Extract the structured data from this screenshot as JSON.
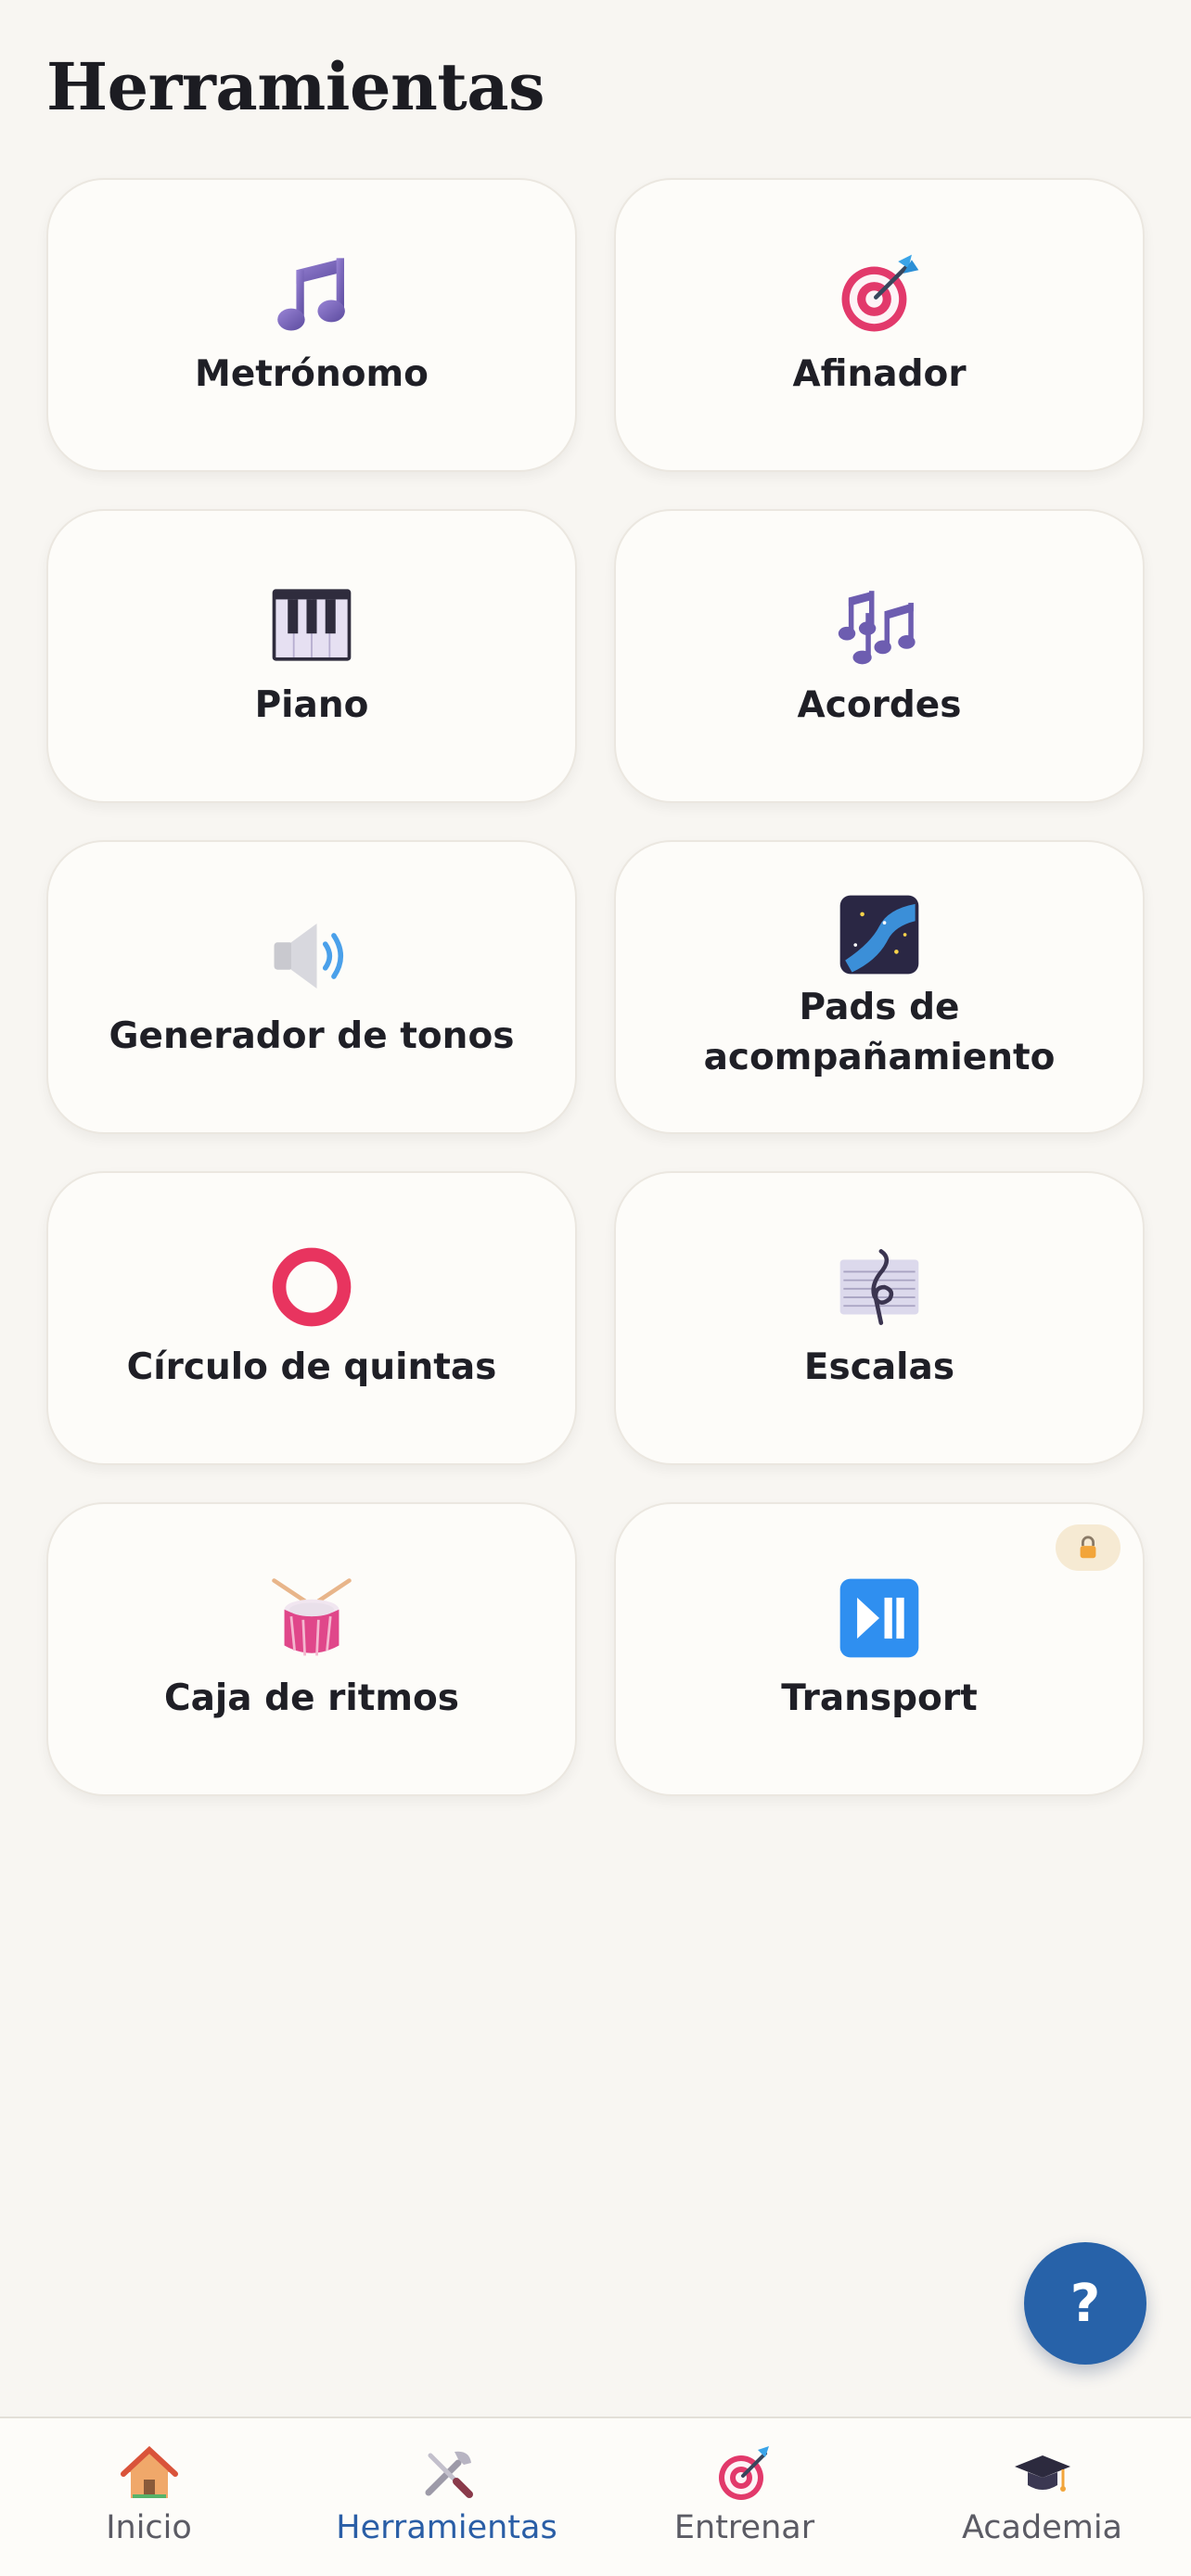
{
  "page": {
    "title": "Herramientas"
  },
  "tools": [
    {
      "label": "Metrónomo",
      "icon": "musical-note-icon"
    },
    {
      "label": "Afinador",
      "icon": "target-icon"
    },
    {
      "label": "Piano",
      "icon": "piano-keys-icon"
    },
    {
      "label": "Acordes",
      "icon": "musical-notes-icon"
    },
    {
      "label": "Generador de tonos",
      "icon": "speaker-icon"
    },
    {
      "label": "Pads de acompañamiento",
      "icon": "milky-way-icon"
    },
    {
      "label": "Círculo de quintas",
      "icon": "ring-icon"
    },
    {
      "label": "Escalas",
      "icon": "musical-score-icon"
    },
    {
      "label": "Caja de ritmos",
      "icon": "drum-icon"
    },
    {
      "label": "Transport",
      "icon": "play-pause-icon",
      "locked": true
    }
  ],
  "help": {
    "label": "?"
  },
  "nav": [
    {
      "label": "Inicio",
      "icon": "house-icon"
    },
    {
      "label": "Herramientas",
      "icon": "tools-icon",
      "active": true
    },
    {
      "label": "Entrenar",
      "icon": "target-icon"
    },
    {
      "label": "Academia",
      "icon": "graduation-cap-icon"
    }
  ],
  "colors": {
    "accent": "#2762a9",
    "background": "#f8f6f2",
    "card": "#fdfcf9",
    "active_nav": "#2a5ea6"
  }
}
